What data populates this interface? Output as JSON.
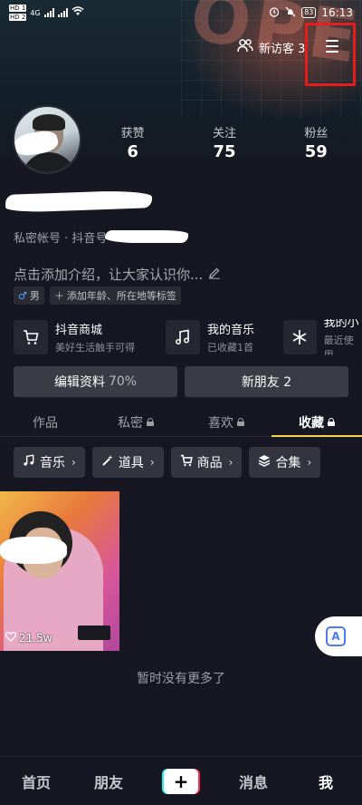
{
  "status_bar": {
    "sim1": "HD 1",
    "sim2": "HD 2",
    "network": "4G",
    "battery": "83",
    "time": "16:13"
  },
  "header": {
    "visitor_label": "新访客 3",
    "menu_icon": "hamburger-menu-icon"
  },
  "profile": {
    "stats": [
      {
        "label": "获赞",
        "value": "6"
      },
      {
        "label": "关注",
        "value": "75"
      },
      {
        "label": "粉丝",
        "value": "59"
      }
    ],
    "meta": "私密帐号 · 抖音号",
    "bio_placeholder": "点击添加介绍，让大家认识你...",
    "gender_tag": "男",
    "add_tag": "添加年龄、所在地等标签"
  },
  "services": [
    {
      "title": "抖音商城",
      "subtitle": "美好生活触手可得",
      "icon": "cart-icon"
    },
    {
      "title": "我的音乐",
      "subtitle": "已收藏1首",
      "icon": "music-note-icon"
    },
    {
      "title": "我的小",
      "subtitle": "最近使用",
      "icon": "sparkle-icon"
    }
  ],
  "actions": {
    "edit_label": "编辑资料",
    "edit_progress": "70%",
    "new_friends": "新朋友 2"
  },
  "tabs": [
    {
      "label": "作品",
      "locked": false
    },
    {
      "label": "私密",
      "locked": true
    },
    {
      "label": "喜欢",
      "locked": true
    },
    {
      "label": "收藏",
      "locked": true,
      "active": true
    }
  ],
  "chips": [
    {
      "label": "音乐",
      "icon": "music-note-icon"
    },
    {
      "label": "道具",
      "icon": "magic-wand-icon"
    },
    {
      "label": "商品",
      "icon": "cart-icon"
    },
    {
      "label": "合集",
      "icon": "layers-icon"
    }
  ],
  "video": {
    "likes": "21.5w"
  },
  "empty_text": "暂时没有更多了",
  "bottom_nav": [
    {
      "label": "首页"
    },
    {
      "label": "朋友"
    },
    {
      "label": "消息"
    },
    {
      "label": "我",
      "active": true
    }
  ],
  "colors": {
    "background": "#161722",
    "accent_tab": "#f2d24a",
    "highlight_box": "#e61d1d"
  }
}
